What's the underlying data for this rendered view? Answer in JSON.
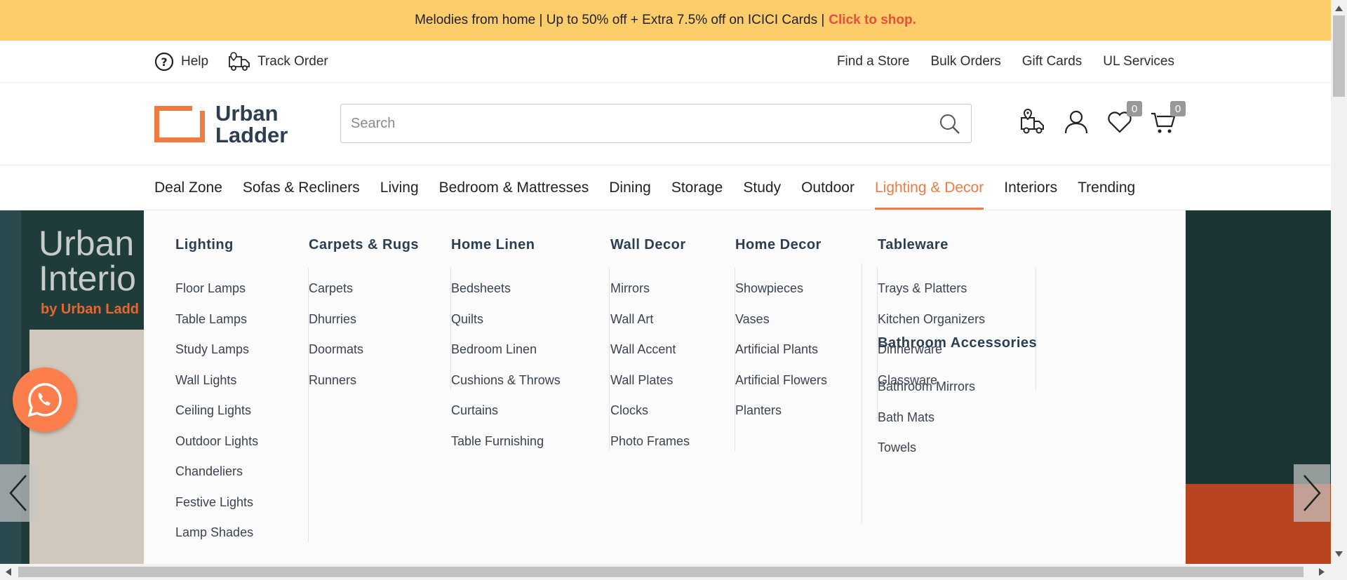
{
  "promo": {
    "text": "Melodies from home | Up to 50% off + Extra 7.5% off on ICICI Cards |",
    "cta": "Click to shop."
  },
  "utility": {
    "help": "Help",
    "track": "Track Order",
    "links": [
      "Find a Store",
      "Bulk Orders",
      "Gift Cards",
      "UL Services"
    ]
  },
  "logo": {
    "line1": "Urban",
    "line2": "Ladder"
  },
  "search": {
    "placeholder": "Search"
  },
  "counts": {
    "wishlist": "0",
    "cart": "0"
  },
  "nav": [
    "Deal Zone",
    "Sofas & Recliners",
    "Living",
    "Bedroom & Mattresses",
    "Dining",
    "Storage",
    "Study",
    "Outdoor",
    "Lighting & Decor",
    "Interiors",
    "Trending"
  ],
  "hero": {
    "title1": "Urban",
    "title2": "Interio",
    "subtitle": "by Urban Ladd"
  },
  "menu": {
    "lighting": {
      "title": "Lighting",
      "items": [
        "Floor Lamps",
        "Table Lamps",
        "Study Lamps",
        "Wall Lights",
        "Ceiling Lights",
        "Outdoor Lights",
        "Chandeliers",
        "Festive Lights",
        "Lamp Shades"
      ]
    },
    "carpets": {
      "title": "Carpets & Rugs",
      "items": [
        "Carpets",
        "Dhurries",
        "Doormats",
        "Runners"
      ]
    },
    "linen": {
      "title": "Home Linen",
      "items": [
        "Bedsheets",
        "Quilts",
        "Bedroom Linen",
        "Cushions & Throws",
        "Curtains",
        "Table Furnishing"
      ]
    },
    "walldecor": {
      "title": "Wall Decor",
      "items": [
        "Mirrors",
        "Wall Art",
        "Wall Accent",
        "Wall Plates",
        "Clocks",
        "Photo Frames"
      ]
    },
    "homedecor": {
      "title": "Home Decor",
      "items": [
        "Showpieces",
        "Vases",
        "Artificial Plants",
        "Artificial Flowers",
        "Planters"
      ]
    },
    "tableware": {
      "title": "Tableware",
      "items": [
        "Trays & Platters",
        "Kitchen Organizers",
        "Dinnerware",
        "Glassware"
      ]
    },
    "bathroom": {
      "title": "Bathroom Accessories",
      "items": [
        "Bathroom Mirrors",
        "Bath Mats",
        "Towels"
      ]
    }
  },
  "colors": {
    "promo_bg": "#fdcc6b",
    "accent": "#f17a40",
    "cta": "#e94e3c"
  }
}
